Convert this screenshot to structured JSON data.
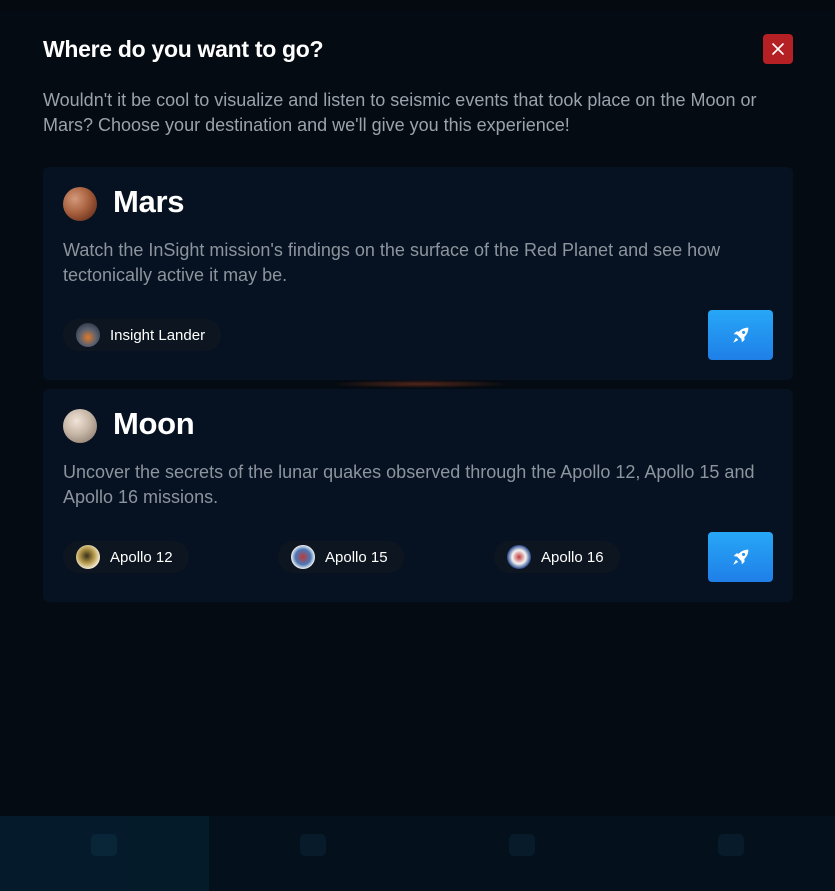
{
  "modal": {
    "title": "Where do you want to go?",
    "intro": "Wouldn't it be cool to visualize and listen to seismic events that took place on the Moon or Mars? Choose your destination and we'll give you this experience!",
    "close_icon": "close-icon"
  },
  "destinations": [
    {
      "name": "Mars",
      "icon": "mars-planet-icon",
      "description": "Watch the InSight mission's findings on the surface of the Red Planet and see how tectonically active it may be.",
      "missions": [
        {
          "label": "Insight Lander",
          "icon": "insight-lander-badge-icon"
        }
      ],
      "go_icon": "rocket-icon"
    },
    {
      "name": "Moon",
      "icon": "moon-planet-icon",
      "description": "Uncover the secrets of the lunar quakes observed through the Apollo 12, Apollo 15 and Apollo 16 missions.",
      "missions": [
        {
          "label": "Apollo 12",
          "icon": "apollo-12-patch-icon"
        },
        {
          "label": "Apollo 15",
          "icon": "apollo-15-patch-icon"
        },
        {
          "label": "Apollo 16",
          "icon": "apollo-16-patch-icon"
        }
      ],
      "go_icon": "rocket-icon"
    }
  ],
  "colors": {
    "background": "#050b12",
    "card": "#061221",
    "close_button": "#b42024",
    "go_button": "#2196f3",
    "chip": "#0d1620"
  }
}
